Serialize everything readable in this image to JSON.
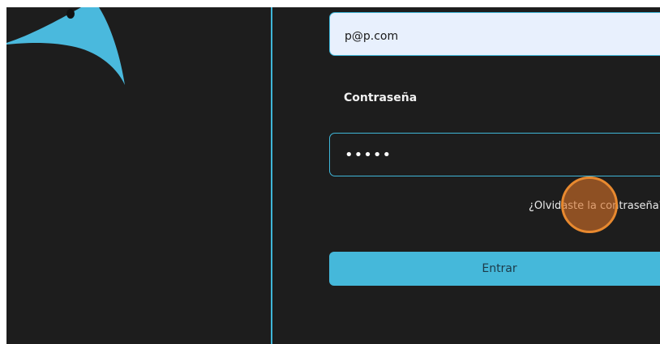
{
  "login_form": {
    "email_value": "p@p.com",
    "password_label": "Contraseña",
    "password_value": "•••••",
    "forgot_password_link": "¿Olvidaste la contraseña?",
    "submit_label": "Entrar"
  },
  "icons": {
    "logo": "bird-logo-icon",
    "click_marker": "click-indicator"
  },
  "colors": {
    "accent": "#45b8da",
    "background": "#1d1d1d",
    "email_fill": "#e8f0fd",
    "click_marker": "#e8892f"
  }
}
